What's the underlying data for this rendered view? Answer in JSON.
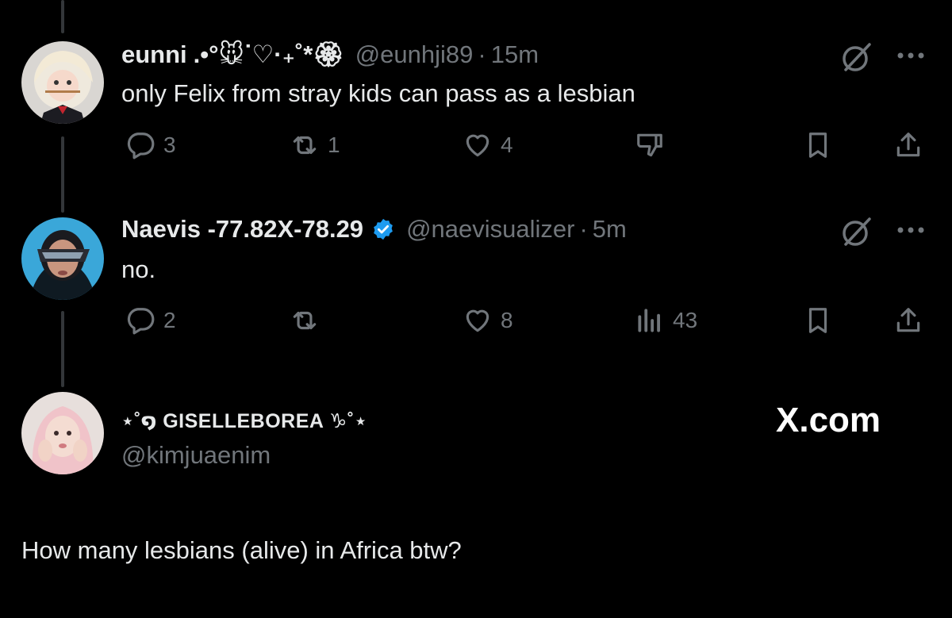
{
  "posts": [
    {
      "name": "eunni",
      "name_deco": ".•°🐭ᐝ♡·₊˚*🏵",
      "handle": "@eunhji89",
      "time": "15m",
      "text": "only Felix from stray kids can pass as a lesbian",
      "replies": "3",
      "reposts": "1",
      "likes": "4"
    },
    {
      "name": "Naevis -77.82X-78.29",
      "handle": "@naevisualizer",
      "time": "5m",
      "text": "no.",
      "replies": "2",
      "reposts": "",
      "likes": "8",
      "views": "43"
    }
  ],
  "quote": {
    "name": "⋆˚໑ GISELLEBOREA ♑︎˚⋆",
    "handle": "@kimjuaenim",
    "text": "How many lesbians (alive) in Africa btw?"
  },
  "watermark": "X.com",
  "dot_separator": "·",
  "colors": {
    "background": "#000000",
    "text": "#e7e9ea",
    "muted": "#71767b",
    "verified": "#1d9bf0"
  }
}
